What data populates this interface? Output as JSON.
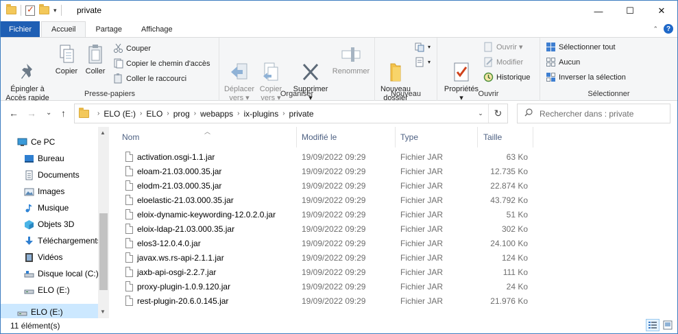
{
  "window": {
    "title": "private",
    "controls": {
      "minimize": "—",
      "maximize": "☐",
      "close": "✕"
    }
  },
  "qat": {
    "dropdown": "▾"
  },
  "tabs": {
    "file": "Fichier",
    "items": [
      "Accueil",
      "Partage",
      "Affichage"
    ],
    "active": "Accueil",
    "help": "?"
  },
  "ribbon": {
    "clipboard": {
      "label": "Presse-papiers",
      "pin": "Épingler à\nAccès rapide",
      "copy": "Copier",
      "paste": "Coller",
      "cut": "Couper",
      "copy_path": "Copier le chemin d'accès",
      "paste_shortcut": "Coller le raccourci"
    },
    "organize": {
      "label": "Organiser",
      "move_to": "Déplacer\nvers ▾",
      "copy_to": "Copier\nvers ▾",
      "delete": "Supprimer\n▾",
      "rename": "Renommer"
    },
    "new": {
      "label": "Nouveau",
      "new_folder": "Nouveau\ndossier"
    },
    "open": {
      "label": "Ouvrir",
      "properties": "Propriétés\n▾",
      "open": "Ouvrir ▾",
      "edit": "Modifier",
      "history": "Historique"
    },
    "select": {
      "label": "Sélectionner",
      "select_all": "Sélectionner tout",
      "select_none": "Aucun",
      "invert": "Inverser la sélection"
    }
  },
  "address": {
    "back": "←",
    "forward": "→",
    "recent": "⌄",
    "up": "↑",
    "breadcrumbs": [
      "ELO (E:)",
      "ELO",
      "prog",
      "webapps",
      "ix-plugins",
      "private"
    ],
    "search_placeholder": "Rechercher dans : private"
  },
  "nav": {
    "items": [
      {
        "label": "Ce PC",
        "icon": "pc-icon"
      },
      {
        "label": "Bureau",
        "icon": "desktop-icon"
      },
      {
        "label": "Documents",
        "icon": "documents-icon"
      },
      {
        "label": "Images",
        "icon": "images-icon"
      },
      {
        "label": "Musique",
        "icon": "music-icon"
      },
      {
        "label": "Objets 3D",
        "icon": "objects3d-icon"
      },
      {
        "label": "Téléchargements",
        "icon": "downloads-icon"
      },
      {
        "label": "Vidéos",
        "icon": "videos-icon"
      },
      {
        "label": "Disque local (C:)",
        "icon": "drive-icon"
      },
      {
        "label": "ELO (E:)",
        "icon": "drive-icon"
      },
      {
        "label": "ELO (E:)",
        "icon": "drive-icon"
      }
    ]
  },
  "columns": {
    "name": "Nom",
    "modified": "Modifié le",
    "type": "Type",
    "size": "Taille"
  },
  "files": [
    {
      "name": "activation.osgi-1.1.jar",
      "modified": "19/09/2022 09:29",
      "type": "Fichier JAR",
      "size": "63 Ko"
    },
    {
      "name": "eloam-21.03.000.35.jar",
      "modified": "19/09/2022 09:29",
      "type": "Fichier JAR",
      "size": "12.735 Ko"
    },
    {
      "name": "elodm-21.03.000.35.jar",
      "modified": "19/09/2022 09:29",
      "type": "Fichier JAR",
      "size": "22.874 Ko"
    },
    {
      "name": "eloelastic-21.03.000.35.jar",
      "modified": "19/09/2022 09:29",
      "type": "Fichier JAR",
      "size": "43.792 Ko"
    },
    {
      "name": "eloix-dynamic-keywording-12.0.2.0.jar",
      "modified": "19/09/2022 09:29",
      "type": "Fichier JAR",
      "size": "51 Ko"
    },
    {
      "name": "eloix-ldap-21.03.000.35.jar",
      "modified": "19/09/2022 09:29",
      "type": "Fichier JAR",
      "size": "302 Ko"
    },
    {
      "name": "elos3-12.0.4.0.jar",
      "modified": "19/09/2022 09:29",
      "type": "Fichier JAR",
      "size": "24.100 Ko"
    },
    {
      "name": "javax.ws.rs-api-2.1.1.jar",
      "modified": "19/09/2022 09:29",
      "type": "Fichier JAR",
      "size": "124 Ko"
    },
    {
      "name": "jaxb-api-osgi-2.2.7.jar",
      "modified": "19/09/2022 09:29",
      "type": "Fichier JAR",
      "size": "111 Ko"
    },
    {
      "name": "proxy-plugin-1.0.9.120.jar",
      "modified": "19/09/2022 09:29",
      "type": "Fichier JAR",
      "size": "24 Ko"
    },
    {
      "name": "rest-plugin-20.6.0.145.jar",
      "modified": "19/09/2022 09:29",
      "type": "Fichier JAR",
      "size": "21.976 Ko"
    }
  ],
  "status": {
    "count": "11 élément(s)"
  },
  "colors": {
    "accent": "#1f5fb4",
    "selection": "#cce8ff",
    "header_text": "#4d6082",
    "meta_text": "#6d6d6d"
  }
}
